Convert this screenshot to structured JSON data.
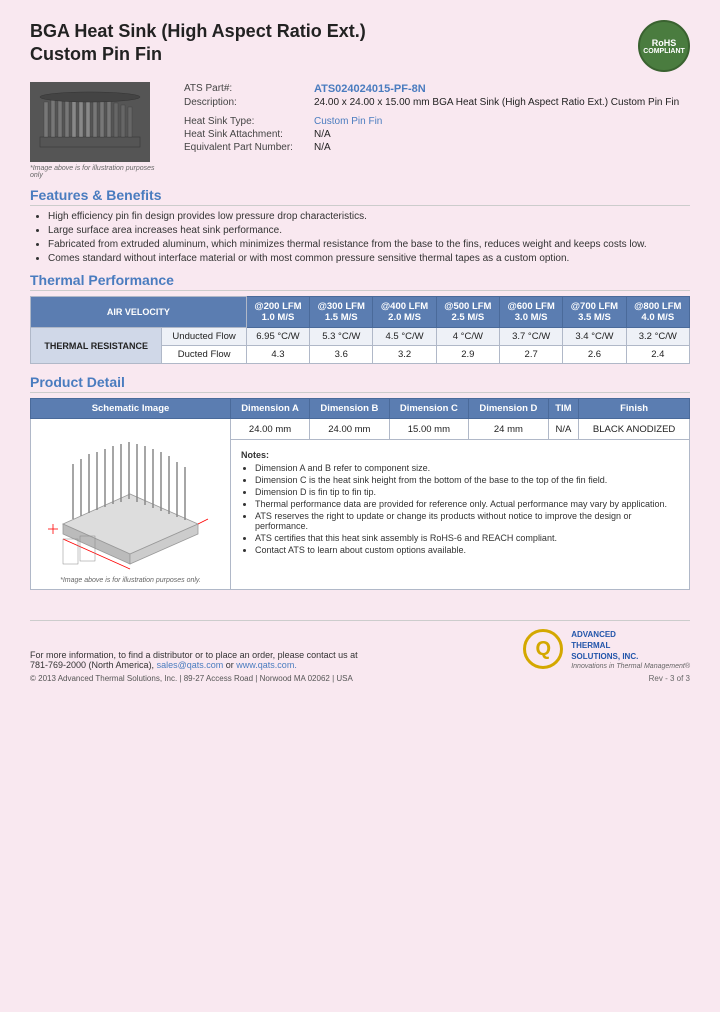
{
  "header": {
    "title_line1": "BGA Heat Sink (High Aspect Ratio Ext.)",
    "title_line2": "Custom Pin Fin",
    "rohs": {
      "line1": "RoHS",
      "line2": "COMPLIANT"
    }
  },
  "product": {
    "part_label": "ATS Part#:",
    "part_number": "ATS024024015-PF-8N",
    "description_label": "Description:",
    "description": "24.00 x 24.00 x 15.00 mm BGA Heat Sink (High Aspect Ratio Ext.) Custom Pin Fin",
    "heat_sink_type_label": "Heat Sink Type:",
    "heat_sink_type": "Custom Pin Fin",
    "attachment_label": "Heat Sink Attachment:",
    "attachment": "N/A",
    "equivalent_label": "Equivalent Part Number:",
    "equivalent": "N/A"
  },
  "image_caption": "*Image above is for illustration purposes only",
  "features": {
    "title": "Features & Benefits",
    "items": [
      "High efficiency pin fin design provides low pressure drop characteristics.",
      "Large surface area increases heat sink performance.",
      "Fabricated from extruded aluminum, which minimizes thermal resistance from the base to the fins, reduces weight and keeps costs low.",
      "Comes standard without interface material or with most common pressure sensitive thermal tapes as a custom option."
    ]
  },
  "thermal_performance": {
    "title": "Thermal Performance",
    "header_row1": {
      "col0": "AIR VELOCITY",
      "col1": "@200 LFM",
      "col2": "@300 LFM",
      "col3": "@400 LFM",
      "col4": "@500 LFM",
      "col5": "@600 LFM",
      "col6": "@700 LFM",
      "col7": "@800 LFM"
    },
    "header_row2": {
      "col1": "1.0 M/S",
      "col2": "1.5 M/S",
      "col3": "2.0 M/S",
      "col4": "2.5 M/S",
      "col5": "3.0 M/S",
      "col6": "3.5 M/S",
      "col7": "4.0 M/S"
    },
    "row_label": "THERMAL RESISTANCE",
    "rows": [
      {
        "type": "Unducted Flow",
        "values": [
          "6.95 °C/W",
          "5.3 °C/W",
          "4.5 °C/W",
          "4 °C/W",
          "3.7 °C/W",
          "3.4 °C/W",
          "3.2 °C/W"
        ]
      },
      {
        "type": "Ducted Flow",
        "values": [
          "4.3",
          "3.6",
          "3.2",
          "2.9",
          "2.7",
          "2.6",
          "2.4"
        ]
      }
    ]
  },
  "product_detail": {
    "title": "Product Detail",
    "columns": [
      "Schematic Image",
      "Dimension A",
      "Dimension B",
      "Dimension C",
      "Dimension D",
      "TIM",
      "Finish"
    ],
    "values": {
      "dim_a": "24.00 mm",
      "dim_b": "24.00 mm",
      "dim_c": "15.00 mm",
      "dim_d": "24 mm",
      "tim": "N/A",
      "finish": "BLACK ANODIZED"
    },
    "schematic_caption": "*Image above is for illustration purposes only.",
    "notes_title": "Notes:",
    "notes": [
      "Dimension A and B refer to component size.",
      "Dimension C is the heat sink height from the bottom of the base to the top of the fin field.",
      "Dimension D is fin tip to fin tip.",
      "Thermal performance data are provided for reference only. Actual performance may vary by application.",
      "ATS reserves the right to update or change its products without notice to improve the design or performance.",
      "ATS certifies that this heat sink assembly is RoHS-6 and REACH compliant.",
      "Contact ATS to learn about custom options available."
    ]
  },
  "footer": {
    "contact_text": "For more information, to find a distributor or to place an order, please contact us at",
    "phone": "781-769-2000 (North America),",
    "email": "sales@qats.com",
    "or": "or",
    "website": "www.qats.com.",
    "copyright": "© 2013 Advanced Thermal Solutions, Inc. | 89-27 Access Road | Norwood MA  02062 | USA",
    "page_number": "Rev - 3 of 3",
    "ats_name_line1": "ADVANCED",
    "ats_name_line2": "THERMAL",
    "ats_name_line3": "SOLUTIONS, INC.",
    "ats_tagline": "Innovations in Thermal Management®"
  }
}
